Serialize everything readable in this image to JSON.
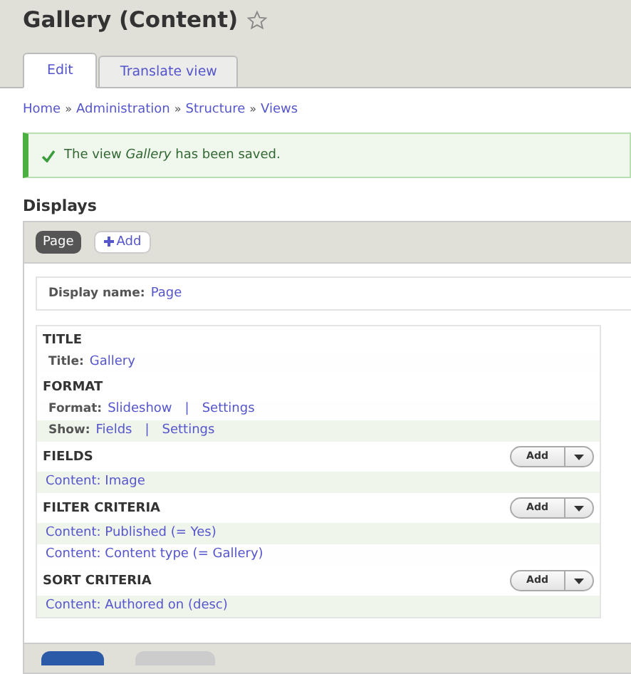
{
  "page_title": "Gallery (Content)",
  "tabs": [
    {
      "label": "Edit",
      "selected": true
    },
    {
      "label": "Translate view",
      "selected": false
    }
  ],
  "breadcrumb": [
    "Home",
    "Administration",
    "Structure",
    "Views"
  ],
  "breadcrumb_separator": "»",
  "link_separator": "|",
  "message": {
    "text": "The view *Gallery* has been saved."
  },
  "displays_heading": "Displays",
  "display_tabs": [
    {
      "label": "Page",
      "selected": true,
      "kind": "tab"
    },
    {
      "label": "Add",
      "selected": false,
      "kind": "add"
    }
  ],
  "display_name": {
    "label": "Display name:",
    "value": "Page"
  },
  "sections": [
    {
      "title": "TITLE",
      "rows": [
        {
          "label": "Title:",
          "links": [
            "Gallery"
          ],
          "shaded": false
        }
      ]
    },
    {
      "title": "FORMAT",
      "rows": [
        {
          "label": "Format:",
          "links": [
            "Slideshow",
            "Settings"
          ],
          "shaded": false
        },
        {
          "label": "Show:",
          "links": [
            "Fields",
            "Settings"
          ],
          "shaded": true
        }
      ]
    },
    {
      "title": "FIELDS",
      "add_button": "Add",
      "rows": [
        {
          "links": [
            "Content: Image"
          ],
          "shaded": true
        }
      ]
    },
    {
      "title": "FILTER CRITERIA",
      "add_button": "Add",
      "rows": [
        {
          "links": [
            "Content: Published (= Yes)"
          ],
          "shaded": true
        },
        {
          "links": [
            "Content: Content type (= Gallery)"
          ],
          "shaded": false
        }
      ]
    },
    {
      "title": "SORT CRITERIA",
      "add_button": "Add",
      "rows": [
        {
          "links": [
            "Content: Authored on (desc)"
          ],
          "shaded": true
        }
      ]
    }
  ]
}
